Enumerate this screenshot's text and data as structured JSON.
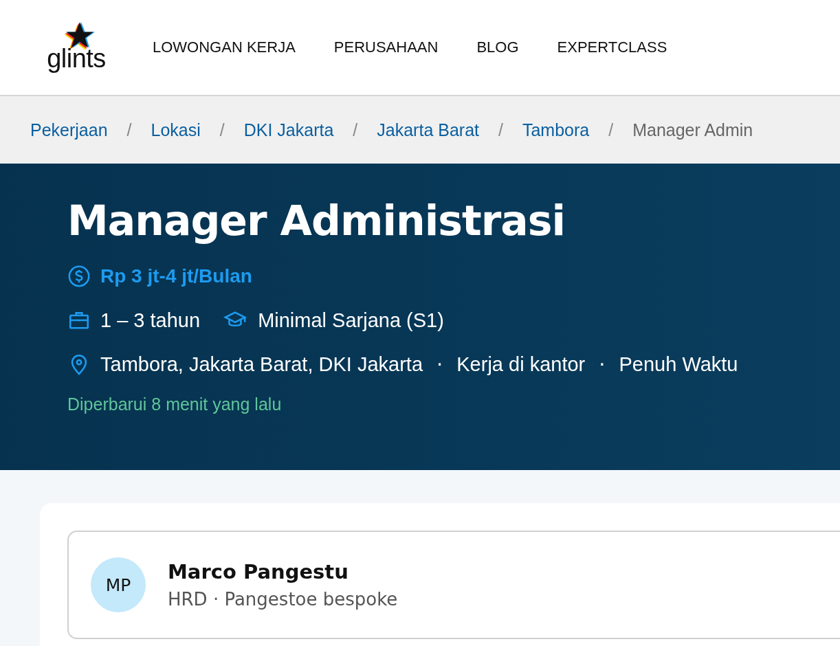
{
  "header": {
    "logo": "glints",
    "nav": [
      {
        "label": "LOWONGAN KERJA"
      },
      {
        "label": "PERUSAHAAN"
      },
      {
        "label": "BLOG"
      },
      {
        "label": "EXPERTCLASS"
      }
    ]
  },
  "breadcrumb": [
    {
      "label": "Pekerjaan",
      "kind": "link"
    },
    {
      "label": "/",
      "kind": "separator"
    },
    {
      "label": "Lokasi",
      "kind": "link"
    },
    {
      "label": "/",
      "kind": "separator"
    },
    {
      "label": "DKI Jakarta",
      "kind": "link"
    },
    {
      "label": "/",
      "kind": "separator"
    },
    {
      "label": "Jakarta Barat",
      "kind": "link"
    },
    {
      "label": "/",
      "kind": "separator"
    },
    {
      "label": "Tambora",
      "kind": "link"
    },
    {
      "label": "/",
      "kind": "separator"
    },
    {
      "label": "Manager Admin",
      "kind": "current"
    }
  ],
  "job": {
    "title": "Manager Administrasi",
    "salary": "Rp 3 jt-4 jt/Bulan",
    "experience": "1 – 3 tahun",
    "education": "Minimal Sarjana (S1)",
    "location": [
      {
        "text": "Tambora, Jakarta Barat, DKI Jakarta",
        "kind": "text"
      },
      {
        "text": "·",
        "kind": "separator"
      },
      {
        "text": "Kerja di kantor",
        "kind": "text"
      },
      {
        "text": "·",
        "kind": "separator"
      },
      {
        "text": "Penuh Waktu",
        "kind": "text"
      }
    ],
    "updated": "Diperbarui 8 menit yang lalu"
  },
  "recruiter": {
    "initials": "MP",
    "name": "Marco Pangestu",
    "role": "HRD · Pangestoe bespoke"
  }
}
